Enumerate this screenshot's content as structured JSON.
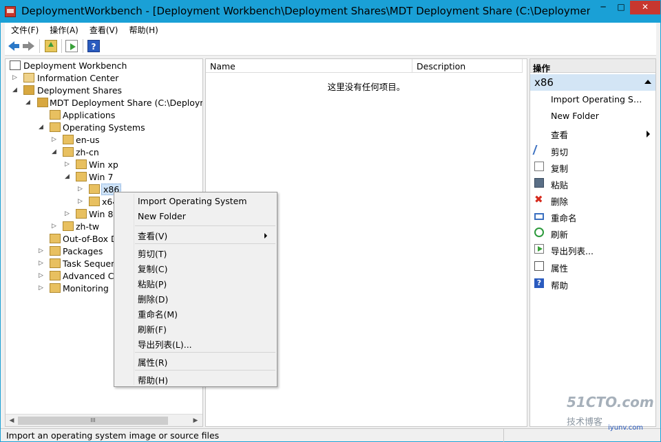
{
  "window": {
    "title": "DeploymentWorkbench - [Deployment Workbench\\Deployment Shares\\MDT Deployment Share (C:\\DeploymentS...",
    "minimize": "─",
    "maximize": "□",
    "close": "✕"
  },
  "menubar": {
    "file": "文件(F)",
    "action": "操作(A)",
    "view": "查看(V)",
    "help": "帮助(H)"
  },
  "toolbar": {
    "help_glyph": "?"
  },
  "tree": {
    "root": "Deployment Workbench",
    "information_center": "Information Center",
    "deployment_shares": "Deployment Shares",
    "mdt_share": "MDT Deployment Share (C:\\Deployme",
    "applications": "Applications",
    "operating_systems": "Operating Systems",
    "en_us": "en-us",
    "zh_cn": "zh-cn",
    "win_xp": "Win xp",
    "win_7": "Win 7",
    "x86": "x86",
    "x64": "x64",
    "win_8": "Win 8",
    "zh_tw": "zh-tw",
    "out_of_box": "Out-of-Box D",
    "packages": "Packages",
    "task_sequences": "Task Sequen",
    "advanced": "Advanced Co",
    "monitoring": "Monitoring",
    "scroll_grip": "III",
    "arrow_left": "◀",
    "arrow_right": "▶"
  },
  "list": {
    "col_name": "Name",
    "col_description": "Description",
    "empty_message": "这里没有任何项目。"
  },
  "actions": {
    "header": "操作",
    "group": "x86",
    "import_os": "Import Operating Sy...",
    "new_folder": "New Folder",
    "view": "查看",
    "cut": "剪切",
    "copy": "复制",
    "paste": "粘贴",
    "delete": "删除",
    "delete_glyph": "✖",
    "rename": "重命名",
    "refresh": "刷新",
    "export_list": "导出列表...",
    "properties": "属性",
    "help": "帮助",
    "help_glyph": "?"
  },
  "context_menu": {
    "import_os": "Import Operating System",
    "new_folder": "New Folder",
    "view": "查看(V)",
    "cut": "剪切(T)",
    "copy": "复制(C)",
    "paste": "粘贴(P)",
    "delete": "删除(D)",
    "rename": "重命名(M)",
    "refresh": "刷新(F)",
    "export_list": "导出列表(L)...",
    "properties": "属性(R)",
    "help": "帮助(H)"
  },
  "status": {
    "text": "Import an operating system image or source files"
  },
  "watermark": {
    "line1": "51CTO.com",
    "line2": "技术博客",
    "line3": "iyunv.com"
  }
}
